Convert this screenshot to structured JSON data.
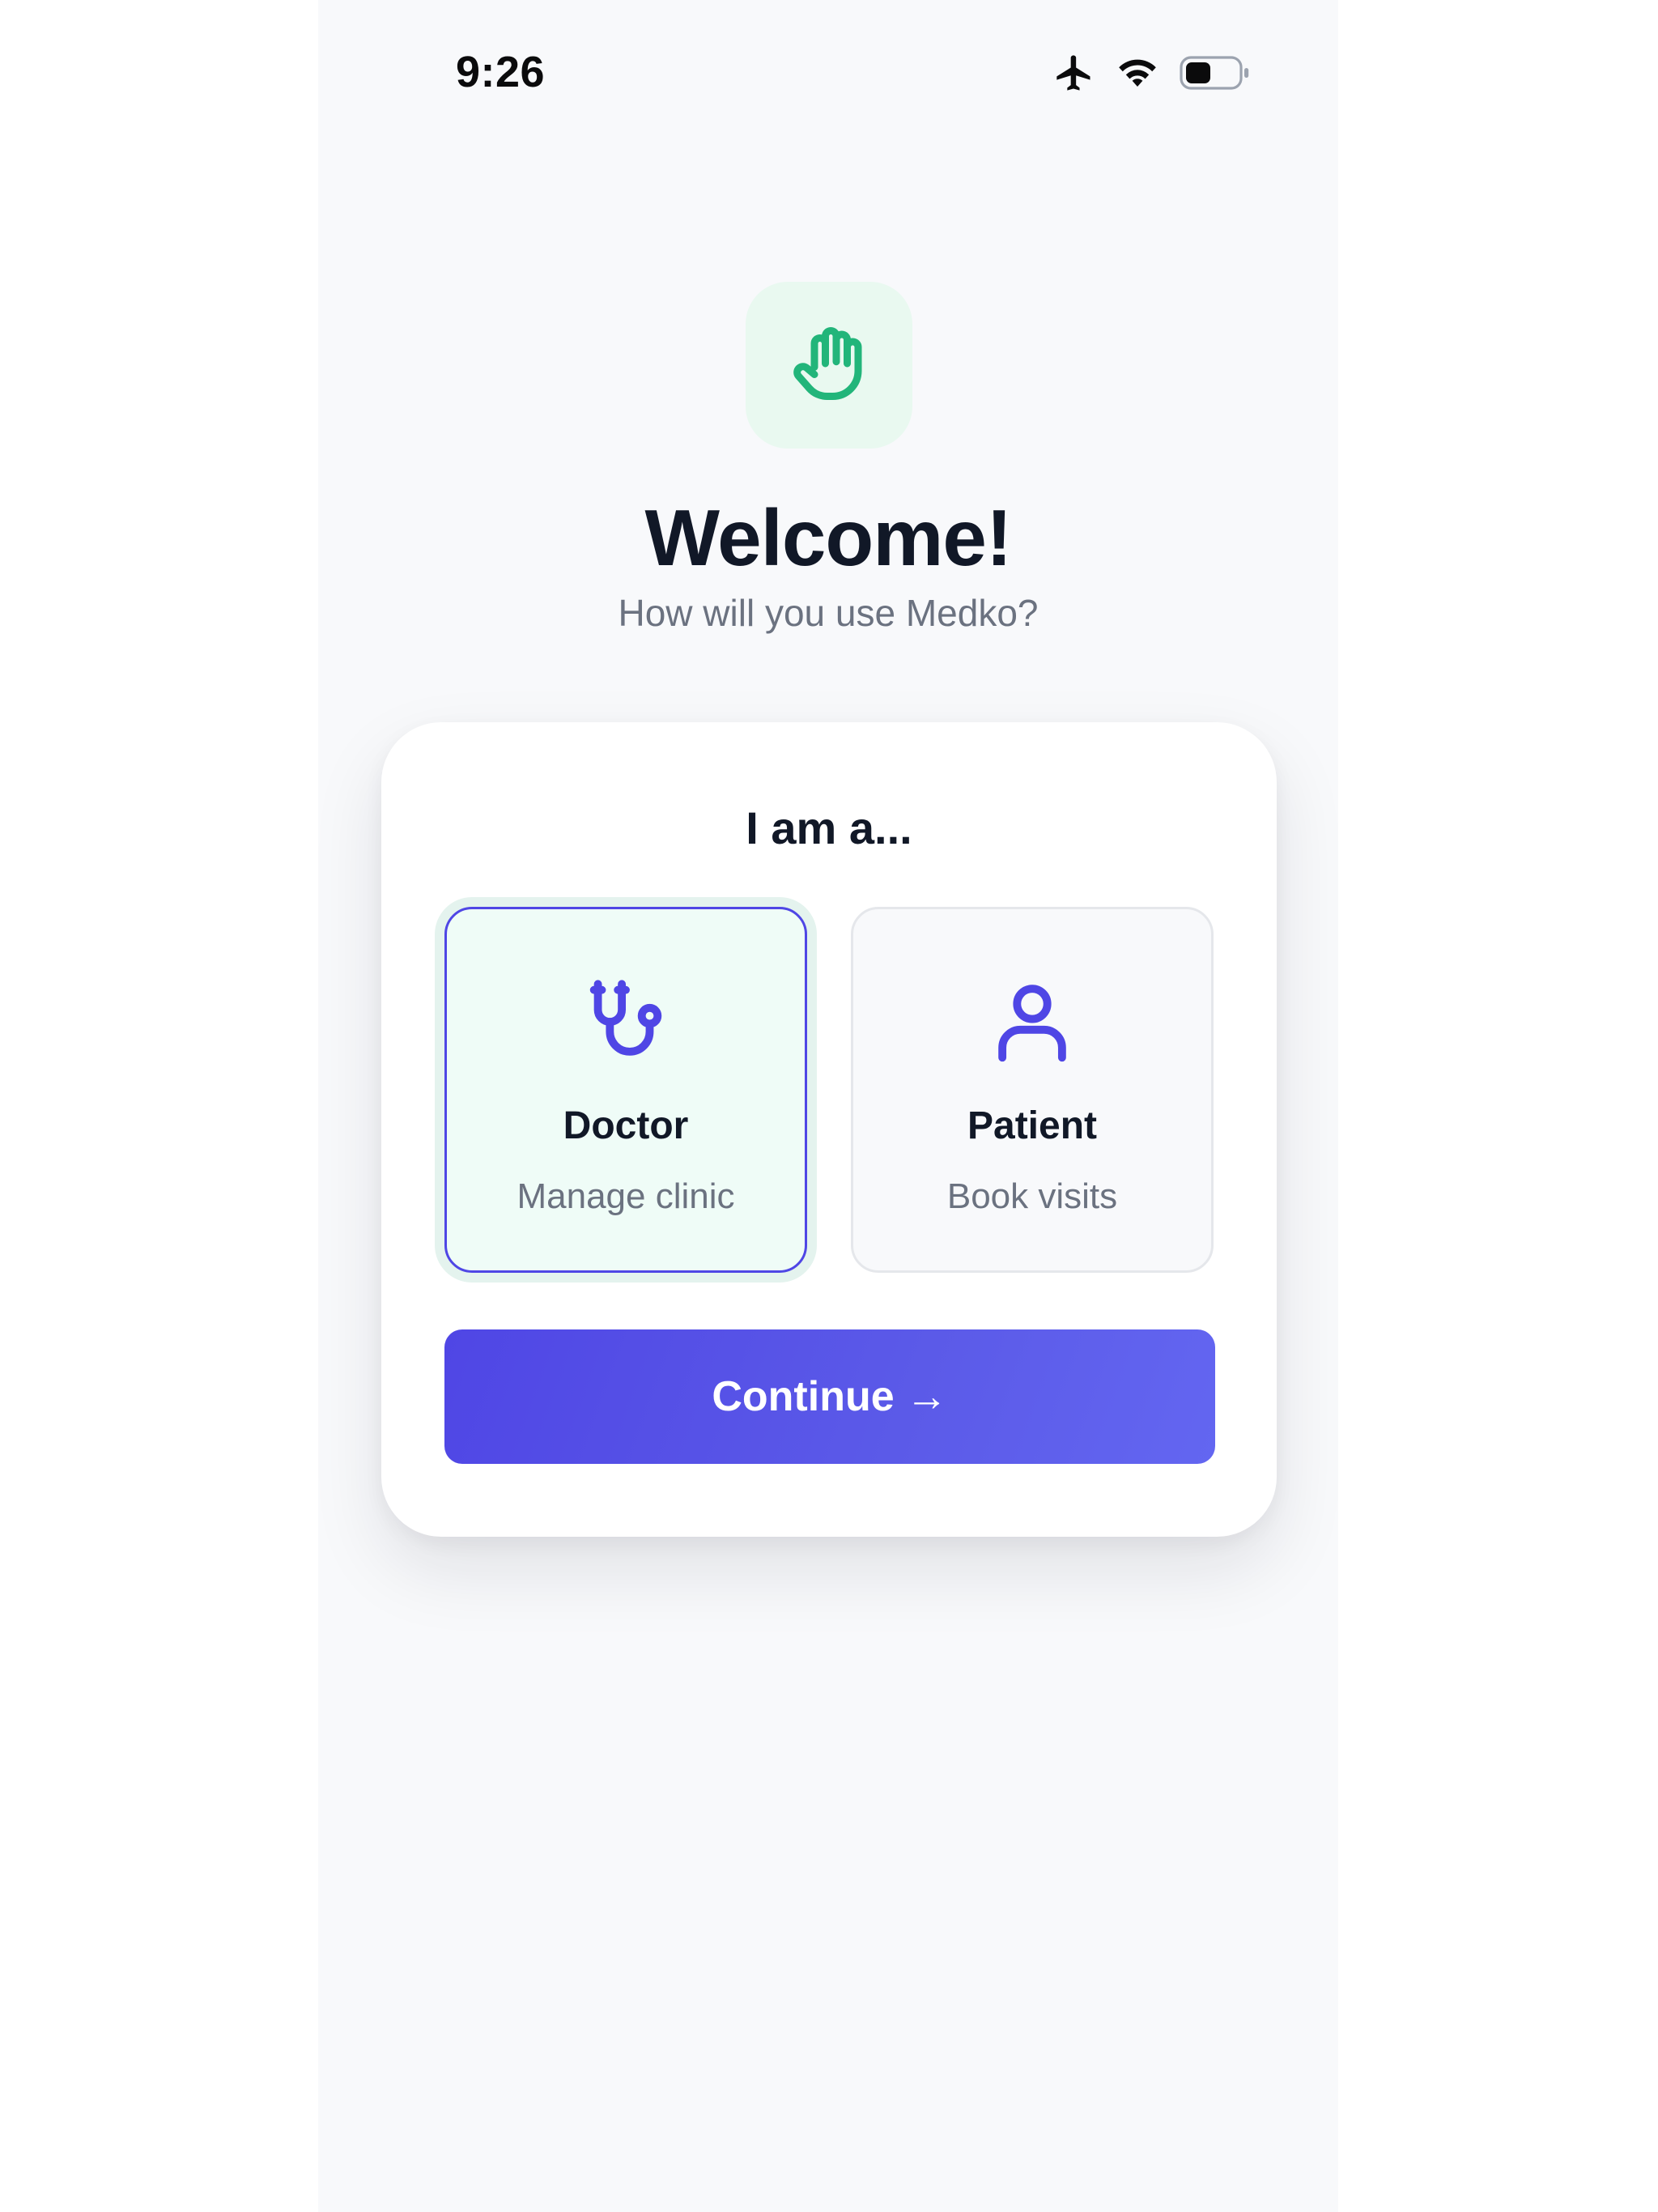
{
  "status_bar": {
    "time": "9:26",
    "icons": [
      "airplane-icon",
      "wifi-icon",
      "battery-icon"
    ]
  },
  "hero": {
    "icon": "hand-wave-icon",
    "title": "Welcome!",
    "subtitle": "How will you use Medko?"
  },
  "role_card": {
    "title": "I am a...",
    "options": [
      {
        "label": "Doctor",
        "description": "Manage clinic",
        "icon": "stethoscope-icon",
        "selected": true
      },
      {
        "label": "Patient",
        "description": "Book visits",
        "icon": "user-icon",
        "selected": false
      }
    ],
    "continue_label": "Continue",
    "continue_arrow": "→"
  },
  "colors": {
    "accent": "#4f46e5",
    "hero_icon": "#22b57a",
    "hero_icon_bg": "#e9f9f0",
    "selected_bg": "#effcf7",
    "title_text": "#111827",
    "muted_text": "#6b7280"
  }
}
